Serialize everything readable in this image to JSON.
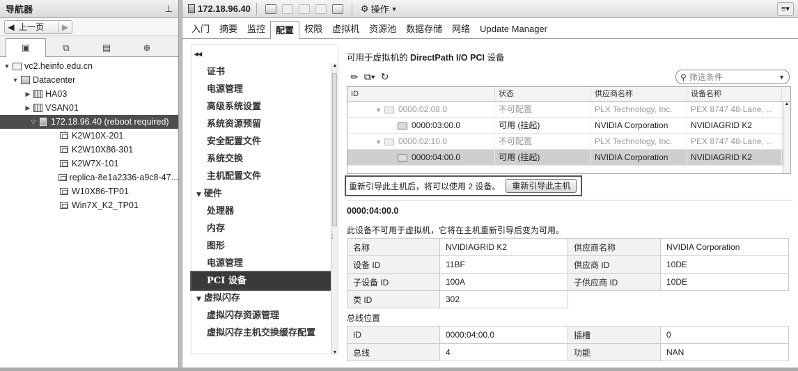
{
  "navigator": {
    "title": "导航器",
    "pin": "⊥",
    "back_label": "上一页",
    "tree": [
      {
        "label": "vc2.heinfo.edu.cn",
        "level": 0,
        "twisty": "▼",
        "icon": "vcenter-icon"
      },
      {
        "label": "Datacenter",
        "level": 1,
        "twisty": "▼",
        "icon": "datacenter-icon"
      },
      {
        "label": "HA03",
        "level": 2,
        "twisty": "▶",
        "icon": "cluster-icon"
      },
      {
        "label": "VSAN01",
        "level": 2,
        "twisty": "▶",
        "icon": "cluster-icon"
      },
      {
        "label": "172.18.96.40 (reboot required)",
        "level": 3,
        "twisty": "▽",
        "icon": "host-icon",
        "selected": true
      },
      {
        "label": "K2W10X-201",
        "level": 4,
        "twisty": "",
        "icon": "vm-icon"
      },
      {
        "label": "K2W10X86-301",
        "level": 4,
        "twisty": "",
        "icon": "vm-icon"
      },
      {
        "label": "K2W7X-101",
        "level": 4,
        "twisty": "",
        "icon": "vm-icon"
      },
      {
        "label": "replica-8e1a2336-a9c8-47...",
        "level": 4,
        "twisty": "",
        "icon": "vm-icon"
      },
      {
        "label": "W10X86-TP01",
        "level": 4,
        "twisty": "",
        "icon": "vm-icon"
      },
      {
        "label": "Win7X_K2_TP01",
        "level": 4,
        "twisty": "",
        "icon": "vm-icon"
      }
    ]
  },
  "header": {
    "title": "172.18.96.40",
    "actions_label": "操作"
  },
  "tabs": [
    "入门",
    "摘要",
    "监控",
    "配置",
    "权限",
    "虚拟机",
    "资源池",
    "数据存储",
    "网络",
    "Update Manager"
  ],
  "active_tab": 3,
  "settings_menu": {
    "collapse": "◂◂",
    "items": [
      {
        "label": "证书",
        "group": false
      },
      {
        "label": "电源管理",
        "group": false
      },
      {
        "label": "高级系统设置",
        "group": false
      },
      {
        "label": "系统资源预留",
        "group": false
      },
      {
        "label": "安全配置文件",
        "group": false
      },
      {
        "label": "系统交换",
        "group": false
      },
      {
        "label": "主机配置文件",
        "group": false
      },
      {
        "label": "硬件",
        "group": true
      },
      {
        "label": "处理器",
        "group": false
      },
      {
        "label": "内存",
        "group": false
      },
      {
        "label": "图形",
        "group": false
      },
      {
        "label": "电源管理",
        "group": false
      },
      {
        "label": "PCI 设备",
        "group": false,
        "active": true
      },
      {
        "label": "虚拟闪存",
        "group": true
      },
      {
        "label": "虚拟闪存资源管理",
        "group": false
      },
      {
        "label": "虚拟闪存主机交换缓存配置",
        "group": false
      }
    ]
  },
  "content": {
    "section_prefix": "可用于虚拟机的",
    "section_bold": "DirectPath I/O PCI",
    "section_suffix": "设备",
    "filter_placeholder": "筛选条件",
    "grid": {
      "columns": [
        "ID",
        "状态",
        "供应商名称",
        "设备名称"
      ],
      "rows": [
        {
          "id": "0000:02:08.0",
          "state": "不可配置",
          "vendor": "PLX Technology, Inc.",
          "device": "PEX 8747 48-Lane, ...",
          "parent": true
        },
        {
          "id": "0000:03:00.0",
          "state": "可用 (挂起)",
          "vendor": "NVIDIA Corporation",
          "device": "NVIDIAGRID K2",
          "parent": false
        },
        {
          "id": "0000:02:10.0",
          "state": "不可配置",
          "vendor": "PLX Technology, Inc.",
          "device": "PEX 8747 48-Lane, ...",
          "parent": true
        },
        {
          "id": "0000:04:00.0",
          "state": "可用 (挂起)",
          "vendor": "NVIDIA Corporation",
          "device": "NVIDIAGRID K2",
          "parent": false,
          "selected": true
        }
      ]
    },
    "notice_text": "重新引导此主机后，将可以使用 2 设备。",
    "reboot_button": "重新引导此主机",
    "device_id": "0000:04:00.0",
    "device_note": "此设备不可用于虚拟机，它将在主机重新引导后变为可用。",
    "details": [
      {
        "k1": "名称",
        "v1": "NVIDIAGRID K2",
        "k2": "供应商名称",
        "v2": "NVIDIA Corporation"
      },
      {
        "k1": "设备 ID",
        "v1": "11BF",
        "k2": "供应商 ID",
        "v2": "10DE"
      },
      {
        "k1": "子设备 ID",
        "v1": "100A",
        "k2": "子供应商 ID",
        "v2": "10DE"
      },
      {
        "k1": "类 ID",
        "v1": "302",
        "k2": "",
        "v2": ""
      }
    ],
    "bus_title": "总线位置",
    "bus": [
      {
        "k1": "ID",
        "v1": "0000:04:00.0",
        "k2": "插槽",
        "v2": "0"
      },
      {
        "k1": "总线",
        "v1": "4",
        "k2": "功能",
        "v2": "NAN"
      }
    ]
  }
}
